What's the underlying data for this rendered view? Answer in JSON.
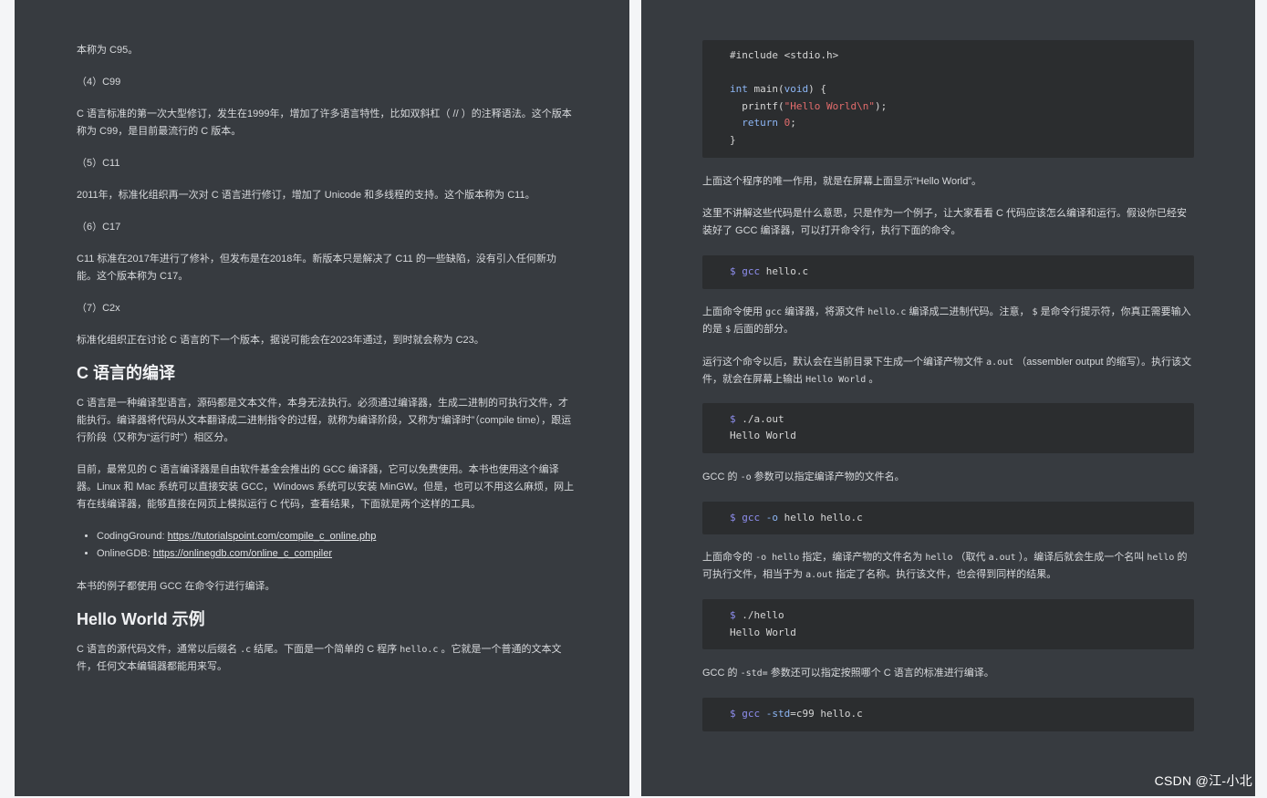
{
  "left": {
    "p1": "本称为 C95。",
    "h_c99": "（4）C99",
    "p_c99": "C 语言标准的第一次大型修订，发生在1999年，增加了许多语言特性，比如双斜杠（ // ）的注释语法。这个版本称为 C99，是目前最流行的 C 版本。",
    "h_c11": "（5）C11",
    "p_c11": "2011年，标准化组织再一次对 C 语言进行修订，增加了 Unicode 和多线程的支持。这个版本称为 C11。",
    "h_c17": "（6）C17",
    "p_c17": "C11 标准在2017年进行了修补，但发布是在2018年。新版本只是解决了 C11 的一些缺陷，没有引入任何新功能。这个版本称为 C17。",
    "h_c2x": "（7）C2x",
    "p_c2x": "标准化组织正在讨论 C 语言的下一个版本，据说可能会在2023年通过，到时就会称为 C23。",
    "h2_compile": "C 语言的编译",
    "p_compile1": "C 语言是一种编译型语言，源码都是文本文件，本身无法执行。必须通过编译器，生成二进制的可执行文件，才能执行。编译器将代码从文本翻译成二进制指令的过程，就称为编译阶段，又称为“编译时”（compile time），跟运行阶段（又称为“运行时”）相区分。",
    "p_compile2": "目前，最常见的 C 语言编译器是自由软件基金会推出的 GCC 编译器，它可以免费使用。本书也使用这个编译器。Linux 和 Mac 系统可以直接安装 GCC，Windows 系统可以安装 MinGW。但是，也可以不用这么麻烦，网上有在线编译器，能够直接在网页上模拟运行 C 代码，查看结果，下面就是两个这样的工具。",
    "list": [
      {
        "label": "CodingGround: ",
        "url": "https://tutorialspoint.com/compile_c_online.php"
      },
      {
        "label": "OnlineGDB: ",
        "url": "https://onlinegdb.com/online_c_compiler"
      }
    ],
    "p_gcc": "本书的例子都使用 GCC 在命令行进行编译。",
    "h2_hello": "Hello World 示例",
    "p_hello_a": "C 语言的源代码文件，通常以后缀名 ",
    "p_hello_code1": ".c",
    "p_hello_b": " 结尾。下面是一个简单的 C 程序 ",
    "p_hello_code2": "hello.c",
    "p_hello_c": " 。它就是一个普通的文本文件，任何文本编辑器都能用来写。"
  },
  "right": {
    "code_main": {
      "line1": "#include <stdio.h>",
      "kw_int": "int",
      "fn_main": " main(",
      "kw_void": "void",
      "brace_open": ") {",
      "printf_a": "  printf(",
      "printf_str": "\"Hello World\\n\"",
      "printf_b": ");",
      "kw_return": "  return",
      "ret_num": "0",
      "ret_end": ";",
      "brace_close": "}"
    },
    "p_only": "上面这个程序的唯一作用，就是在屏幕上面显示“Hello World”。",
    "p_explain": "这里不讲解这些代码是什么意思，只是作为一个例子，让大家看看 C 代码应该怎么编译和运行。假设你已经安装好了 GCC 编译器，可以打开命令行，执行下面的命令。",
    "cmd1": {
      "prompt": "$ gcc",
      "rest": " hello.c"
    },
    "p_cmd1_a": "上面命令使用 ",
    "p_cmd1_code1": "gcc",
    "p_cmd1_b": " 编译器，将源文件 ",
    "p_cmd1_code2": "hello.c",
    "p_cmd1_c": " 编译成二进制代码。注意， ",
    "p_cmd1_code3": "$",
    "p_cmd1_d": " 是命令行提示符，你真正需要输入的是 ",
    "p_cmd1_code4": "$",
    "p_cmd1_e": " 后面的部分。",
    "p_run_a": "运行这个命令以后，默认会在当前目录下生成一个编译产物文件 ",
    "p_run_code1": "a.out",
    "p_run_b": " （assembler output 的缩写）。执行该文件，就会在屏幕上输出 ",
    "p_run_code2": "Hello World",
    "p_run_c": " 。",
    "cmd2": {
      "prompt": "$",
      "rest": " ./a.out",
      "output": "Hello World"
    },
    "p_o_a": "GCC 的 ",
    "p_o_code": "-o",
    "p_o_b": " 参数可以指定编译产物的文件名。",
    "cmd3": {
      "prompt": "$ gcc",
      "flag": " -o",
      "rest": " hello hello.c"
    },
    "p_o2_a": "上面命令的 ",
    "p_o2_code1": "-o hello",
    "p_o2_b": " 指定，编译产物的文件名为 ",
    "p_o2_code2": "hello",
    "p_o2_c": " （取代 ",
    "p_o2_code3": "a.out",
    "p_o2_d": " ）。编译后就会生成一个名叫 ",
    "p_o2_code4": "hello",
    "p_o2_e": " 的可执行文件，相当于为 ",
    "p_o2_code5": "a.out",
    "p_o2_f": " 指定了名称。执行该文件，也会得到同样的结果。",
    "cmd4": {
      "prompt": "$",
      "rest": " ./hello",
      "output": "Hello World"
    },
    "p_std_a": "GCC 的 ",
    "p_std_code": "-std=",
    "p_std_b": " 参数还可以指定按照哪个 C 语言的标准进行编译。",
    "cmd5": {
      "prompt": "$ gcc",
      "flag": " -std",
      "eq": "=",
      "rest": "c99 hello.c"
    }
  },
  "watermark": "CSDN @江-小北"
}
